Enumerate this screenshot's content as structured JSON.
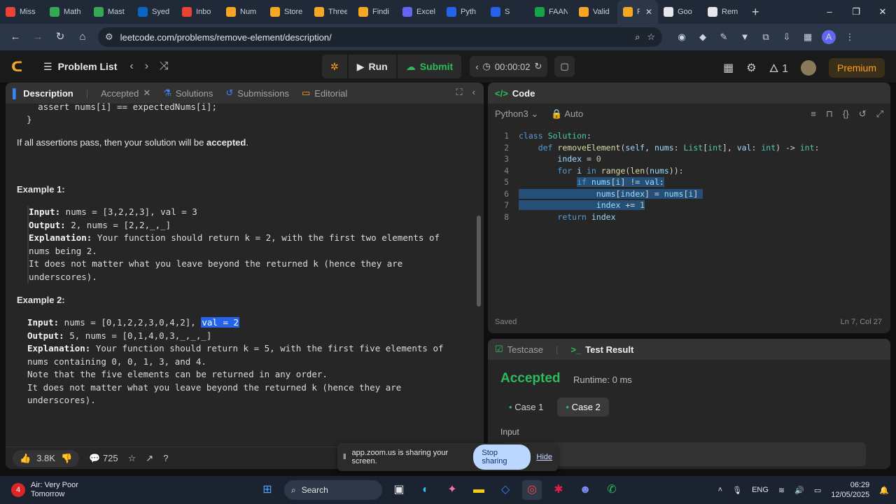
{
  "browser": {
    "tabs": [
      {
        "title": "Miss",
        "color": "#ea4335"
      },
      {
        "title": "Math",
        "color": "#34a853"
      },
      {
        "title": "Mast",
        "color": "#34a853"
      },
      {
        "title": "Syed",
        "color": "#0a66c2"
      },
      {
        "title": "Inbo",
        "color": "#ea4335"
      },
      {
        "title": "Num",
        "color": "#f5a623"
      },
      {
        "title": "Store",
        "color": "#f5a623"
      },
      {
        "title": "Three",
        "color": "#f5a623"
      },
      {
        "title": "Findi",
        "color": "#f5a623"
      },
      {
        "title": "Excel",
        "color": "#6366f1"
      },
      {
        "title": "Pyth",
        "color": "#2563eb"
      },
      {
        "title": "S",
        "color": "#2563eb"
      },
      {
        "title": "FAAN",
        "color": "#16a34a"
      },
      {
        "title": "Valid",
        "color": "#f5a623"
      },
      {
        "title": "F",
        "color": "#f5a623"
      },
      {
        "title": "Goo",
        "color": "#e5e7eb"
      },
      {
        "title": "Rem",
        "color": "#e5e7eb"
      }
    ],
    "url": "leetcode.com/problems/remove-element/description/",
    "profile_initial": "A"
  },
  "nav": {
    "problem_list": "Problem List",
    "run": "Run",
    "submit": "Submit",
    "timer": "00:00:02",
    "streak": "1",
    "premium": "Premium"
  },
  "left_tabs": {
    "description": "Description",
    "accepted": "Accepted",
    "solutions": "Solutions",
    "submissions": "Submissions",
    "editorial": "Editorial"
  },
  "description": {
    "code_line1": "    assert nums[i] == expectedNums[i];",
    "code_line2": "}",
    "assertions_pre": "If all assertions pass, then your solution will be ",
    "assertions_bold": "accepted",
    "assertions_post": ".",
    "example1_title": "Example 1:",
    "ex1_input_label": "Input:",
    "ex1_input": " nums = [3,2,2,3], val = 3",
    "ex1_output_label": "Output:",
    "ex1_output": " 2, nums = [2,2,_,_]",
    "ex1_expl_label": "Explanation:",
    "ex1_expl_1": " Your function should return k = 2, with the first two elements of",
    "ex1_expl_2": "nums being 2.",
    "ex1_expl_3": "It does not matter what you leave beyond the returned k (hence they are",
    "ex1_expl_4": "underscores).",
    "example2_title": "Example 2:",
    "ex2_input_label": "Input:",
    "ex2_input": " nums = [0,1,2,2,3,0,4,2], ",
    "ex2_input_sel": "val = 2",
    "ex2_output_label": "Output:",
    "ex2_output": " 5, nums = [0,1,4,0,3,_,_,_]",
    "ex2_expl_label": "Explanation:",
    "ex2_expl_1": " Your function should return k = 5, with the first five elements of",
    "ex2_expl_2": "nums containing 0, 0, 1, 3, and 4.",
    "ex2_expl_3": "Note that the five elements can be returned in any order.",
    "ex2_expl_4": "It does not matter what you leave beyond the returned k (hence they are",
    "ex2_expl_5": "underscores)."
  },
  "footer": {
    "likes": "3.8K",
    "comments": "725"
  },
  "code_panel": {
    "title": "Code",
    "language": "Python3",
    "mode": "Auto",
    "saved": "Saved",
    "cursor": "Ln 7, Col 27",
    "lines": [
      "1",
      "2",
      "3",
      "4",
      "5",
      "6",
      "7",
      "8"
    ]
  },
  "test_panel": {
    "testcase_tab": "Testcase",
    "result_tab": "Test Result",
    "status": "Accepted",
    "runtime": "Runtime: 0 ms",
    "case1": "Case 1",
    "case2": "Case 2",
    "input_label": "Input"
  },
  "share_bar": {
    "text": "app.zoom.us is sharing your screen.",
    "stop": "Stop sharing",
    "hide": "Hide"
  },
  "taskbar": {
    "weather_badge": "4",
    "weather_line1": "Air: Very Poor",
    "weather_line2": "Tomorrow",
    "search": "Search",
    "lang": "ENG",
    "time": "06:29",
    "date": "12/05/2025"
  },
  "colors": {
    "accent_green": "#2cbb5d",
    "premium": "#ffa116",
    "selection": "#2563eb"
  }
}
